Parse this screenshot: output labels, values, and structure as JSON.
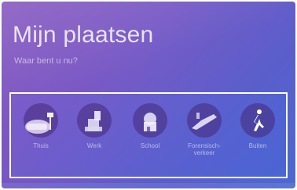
{
  "header": {
    "title": "Mijn plaatsen",
    "subtitle": "Waar bent u nu?"
  },
  "places": [
    {
      "label": "Thuis",
      "icon": "home-icon"
    },
    {
      "label": "Werk",
      "icon": "work-icon"
    },
    {
      "label": "School",
      "icon": "school-icon"
    },
    {
      "label": "Forensisch-verkeer",
      "icon": "commute-icon"
    },
    {
      "label": "Buiten",
      "icon": "walking-icon"
    }
  ],
  "colors": {
    "gradient_start": "#8a5dc0",
    "gradient_end": "#4c68d0",
    "selection_border": "#ffffff"
  }
}
